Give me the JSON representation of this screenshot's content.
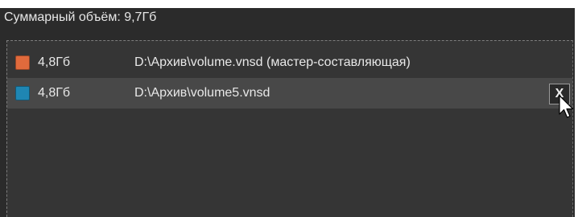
{
  "header": {
    "total_label": "Суммарный объём: 9,7Гб"
  },
  "volumes": [
    {
      "size": "4,8Гб",
      "path": "D:\\Архив\\volume.vnsd (мастер-составляющая)",
      "color": "#e06a3c",
      "selected": false
    },
    {
      "size": "4,8Гб",
      "path": "D:\\Архив\\volume5.vnsd",
      "color": "#1f86b3",
      "selected": true
    }
  ],
  "remove_button": {
    "label": "X"
  },
  "cursor": {
    "icon": "mouse-pointer-icon"
  }
}
